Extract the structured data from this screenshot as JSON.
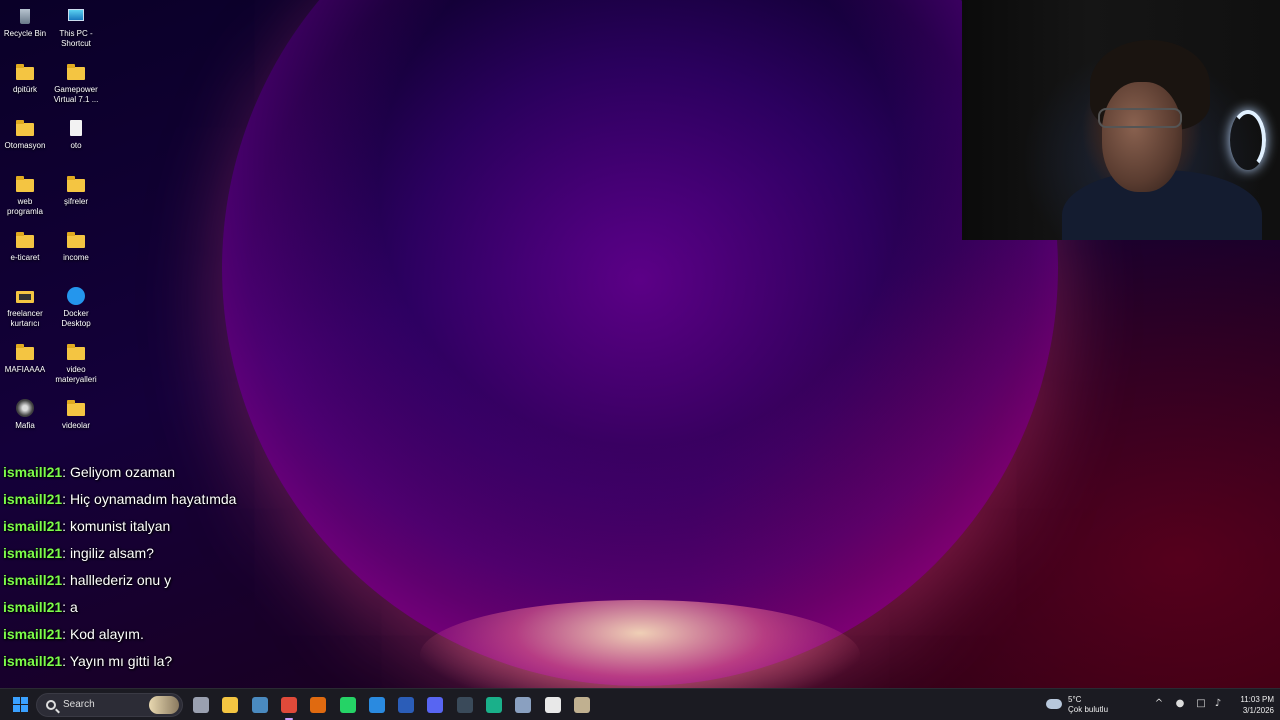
{
  "desktop": {
    "icons": [
      {
        "label": "Recycle Bin",
        "icon": "recycle-bin-icon"
      },
      {
        "label": "This PC - Shortcut",
        "icon": "this-pc-icon"
      },
      {
        "label": "dpitürk",
        "icon": "folder-icon"
      },
      {
        "label": "Gamepower Virtual 7.1 ...",
        "icon": "folder-icon"
      },
      {
        "label": "Otomasyon",
        "icon": "folder-icon"
      },
      {
        "label": "oto",
        "icon": "document-icon"
      },
      {
        "label": "web programla",
        "icon": "folder-icon"
      },
      {
        "label": "şifreler",
        "icon": "folder-icon"
      },
      {
        "label": "e-ticaret",
        "icon": "folder-icon"
      },
      {
        "label": "income",
        "icon": "folder-icon"
      },
      {
        "label": "freelancer kurtarıcı",
        "icon": "folder-icon"
      },
      {
        "label": "Docker Desktop",
        "icon": "docker-icon"
      },
      {
        "label": "MAFIAAAA",
        "icon": "folder-icon"
      },
      {
        "label": "video materyalleri",
        "icon": "folder-icon"
      },
      {
        "label": "Mafia",
        "icon": "mafia-game-icon"
      },
      {
        "label": "videolar",
        "icon": "folder-icon"
      }
    ]
  },
  "chat": {
    "messages": [
      {
        "user": "ismaill21",
        "text": "Geliyom ozaman"
      },
      {
        "user": "ismaill21",
        "text": "Hiç oynamadım hayatımda"
      },
      {
        "user": "ismaill21",
        "text": "komunist italyan"
      },
      {
        "user": "ismaill21",
        "text": "ingiliz alsam?"
      },
      {
        "user": "ismaill21",
        "text": "halllederiz onu y"
      },
      {
        "user": "ismaill21",
        "text": "a"
      },
      {
        "user": "ismaill21",
        "text": "Kod alayım."
      },
      {
        "user": "ismaill21",
        "text": "Yayın mı gitti la?"
      }
    ]
  },
  "taskbar": {
    "search_label": "Search",
    "apps": [
      {
        "name": "task-view-icon",
        "color": "#9aa0b0"
      },
      {
        "name": "file-explorer-icon",
        "color": "#f4c542"
      },
      {
        "name": "steam-icon",
        "color": "#4a8ac0"
      },
      {
        "name": "chrome-icon",
        "color": "#e04a3a",
        "active": true
      },
      {
        "name": "app-orange-icon",
        "color": "#e06a10"
      },
      {
        "name": "whatsapp-icon",
        "color": "#25d366"
      },
      {
        "name": "vscode-icon",
        "color": "#2a8ae0"
      },
      {
        "name": "word-icon",
        "color": "#2b5db8"
      },
      {
        "name": "discord-icon",
        "color": "#5865f2"
      },
      {
        "name": "capcut-icon",
        "color": "#3a4a5a"
      },
      {
        "name": "app-green-icon",
        "color": "#1ab08a"
      },
      {
        "name": "app-gear-icon",
        "color": "#8aa0c0"
      },
      {
        "name": "notepad-icon",
        "color": "#e8e8e8"
      },
      {
        "name": "mafia-taskbar-icon",
        "color": "#c0b090"
      }
    ]
  },
  "tray": {
    "weather_temp": "5°C",
    "weather_desc": "Çok bulutlu",
    "time": "11:03 PM",
    "date": "3/1/2026"
  }
}
